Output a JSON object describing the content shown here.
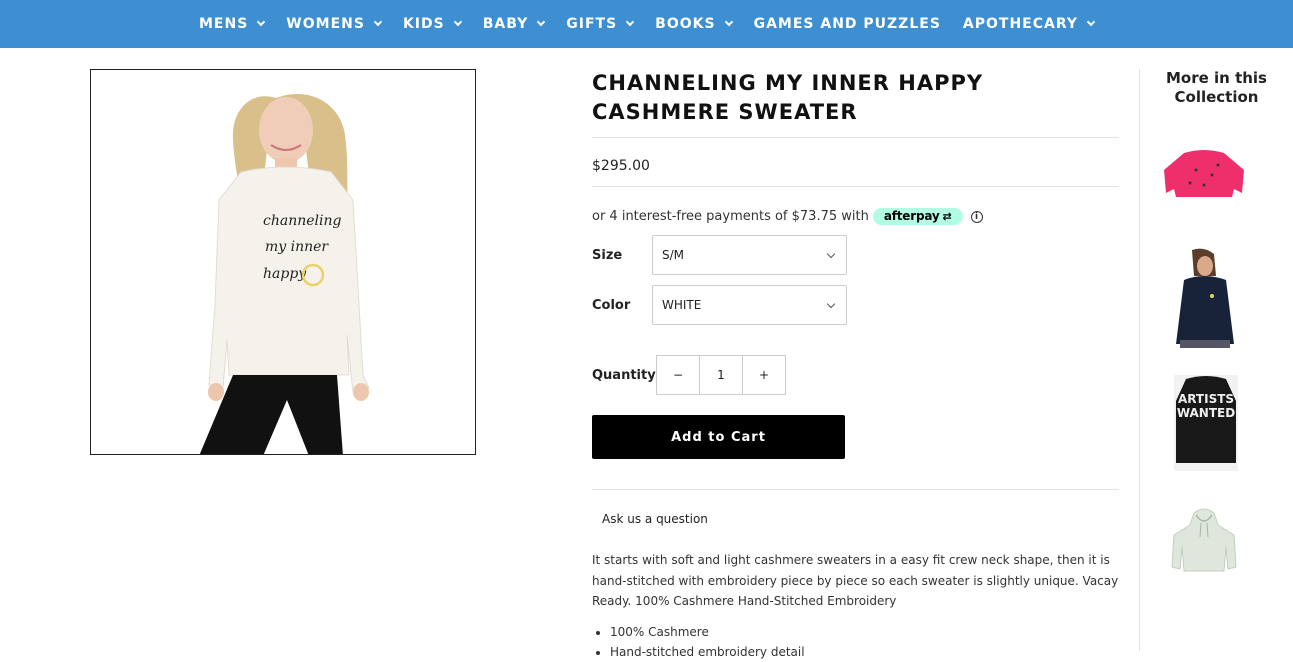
{
  "nav": {
    "items": [
      {
        "label": "MENS",
        "dropdown": true
      },
      {
        "label": "WOMENS",
        "dropdown": true
      },
      {
        "label": "KIDS",
        "dropdown": true
      },
      {
        "label": "BABY",
        "dropdown": true
      },
      {
        "label": "GIFTS",
        "dropdown": true
      },
      {
        "label": "BOOKS",
        "dropdown": true
      },
      {
        "label": "GAMES AND PUZZLES",
        "dropdown": false
      },
      {
        "label": "APOTHECARY",
        "dropdown": true
      }
    ]
  },
  "product": {
    "title": "CHANNELING MY INNER HAPPY CASHMERE SWEATER",
    "price": "$295.00",
    "afterpay_text": "or 4 interest-free payments of $73.75 with",
    "afterpay_brand": "afterpay",
    "image_text": {
      "line1": "channeling",
      "line2": "my inner",
      "line3": "happy"
    },
    "size_label": "Size",
    "size_value": "S/M",
    "color_label": "Color",
    "color_value": "WHITE",
    "quantity_label": "Quantity",
    "quantity_minus": "−",
    "quantity_value": "1",
    "quantity_plus": "+",
    "add_to_cart": "Add to Cart",
    "ask_question": "Ask us a question",
    "description": "It starts with soft and light cashmere sweaters in a easy fit crew neck shape, then it is hand-stitched with embroidery piece by piece so each sweater is slightly unique. Vacay Ready. 100% Cashmere Hand-Stitched Embroidery",
    "bullets": [
      "100% Cashmere",
      "Hand-stitched embroidery detail"
    ]
  },
  "sidebar": {
    "heading": "More in this Collection",
    "thumb3_text": {
      "line1": "ARTISTS",
      "line2": "WANTED"
    }
  },
  "colors": {
    "nav_bg": "#3e8fd2",
    "afterpay_mint": "#b2fce4",
    "button_bg": "#000000"
  }
}
